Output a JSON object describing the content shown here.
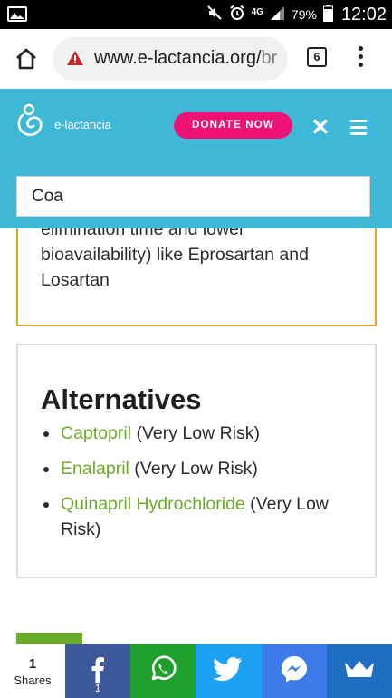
{
  "status_bar": {
    "network": "4G",
    "battery": "79%",
    "time": "12:02"
  },
  "browser": {
    "url_main": "www.e-lactancia.org/",
    "url_rest": "br",
    "tab_count": "6"
  },
  "site": {
    "logo_text": "e-lactancia",
    "donate_label": "DONATE NOW",
    "close_glyph": "✕",
    "search_value": "Coa"
  },
  "warning": {
    "text": "elimination time and lower bioavailability) like Eprosartan and Losartan",
    "border_color": "#e5a427"
  },
  "alternatives": {
    "heading": "Alternatives",
    "items": [
      {
        "drug": "Captopril",
        "risk": " (Very Low Risk)"
      },
      {
        "drug": "Enalapril",
        "risk": " (Very Low Risk)"
      },
      {
        "drug": "Quinapril Hydrochloride",
        "risk": " (Very Low Risk)"
      }
    ]
  },
  "share": {
    "count": "1",
    "label": "Shares",
    "facebook_count": "1",
    "buttons": [
      "facebook-icon",
      "whatsapp-icon",
      "twitter-icon",
      "messenger-icon",
      "crown-icon"
    ]
  },
  "colors": {
    "header": "#3fb7d6",
    "donate": "#ef1174",
    "link_green": "#6aab2a",
    "facebook": "#3b5998",
    "whatsapp": "#1fa02d",
    "twitter": "#1da1f2",
    "messenger": "#3b7bea",
    "more": "#1e6fc3"
  }
}
